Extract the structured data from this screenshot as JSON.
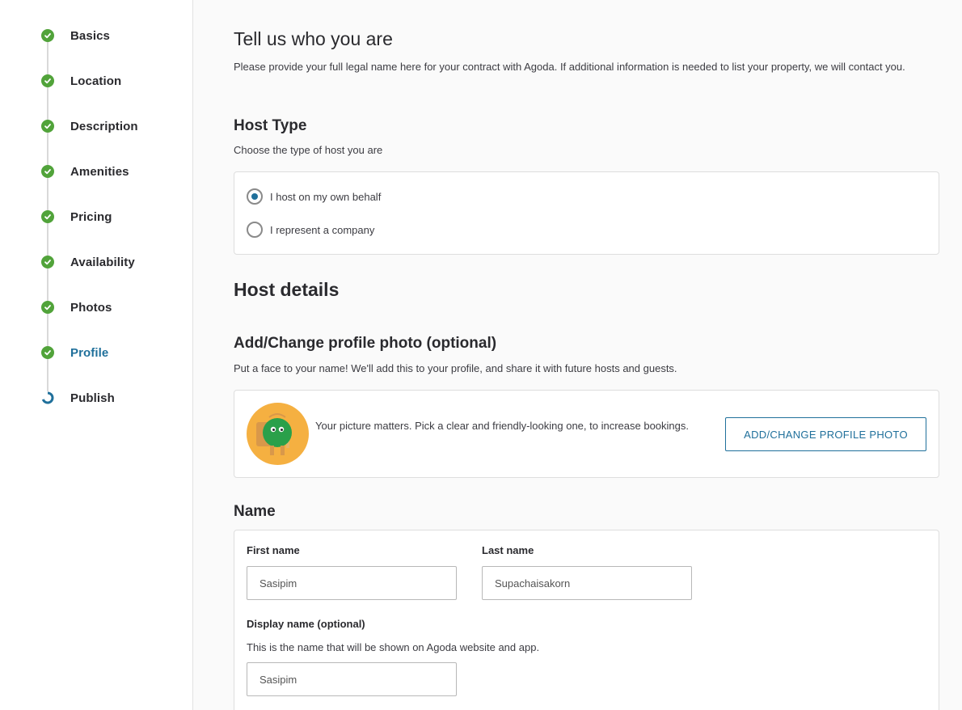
{
  "sidebar": {
    "steps": [
      {
        "label": "Basics",
        "status": "done"
      },
      {
        "label": "Location",
        "status": "done"
      },
      {
        "label": "Description",
        "status": "done"
      },
      {
        "label": "Amenities",
        "status": "done"
      },
      {
        "label": "Pricing",
        "status": "done"
      },
      {
        "label": "Availability",
        "status": "done"
      },
      {
        "label": "Photos",
        "status": "done"
      },
      {
        "label": "Profile",
        "status": "active"
      },
      {
        "label": "Publish",
        "status": "in-progress"
      }
    ]
  },
  "main": {
    "title": "Tell us who you are",
    "intro": "Please provide your full legal name here for your contract with Agoda. If additional information is needed to list your property, we will contact you.",
    "host_type": {
      "heading": "Host Type",
      "subtitle": "Choose the type of host you are",
      "options": [
        {
          "label": "I host on my own behalf",
          "selected": true
        },
        {
          "label": "I represent a company",
          "selected": false
        }
      ]
    },
    "host_details": {
      "heading": "Host details"
    },
    "profile_photo": {
      "heading": "Add/Change profile photo (optional)",
      "subtitle": "Put a face to your name! We'll add this to your profile, and share it with future hosts and guests.",
      "tip": "Your picture matters. Pick a clear and friendly-looking one, to increase bookings.",
      "button_label": "ADD/CHANGE PROFILE PHOTO"
    },
    "name": {
      "heading": "Name",
      "first_name_label": "First name",
      "first_name_value": "Sasipim",
      "last_name_label": "Last name",
      "last_name_value": "Supachaisakorn",
      "display_name_label": "Display name (optional)",
      "display_name_help": "This is the name that will be shown on Agoda website and app.",
      "display_name_value": "Sasipim"
    }
  },
  "colors": {
    "accent": "#20709b",
    "success": "#51a33a",
    "avatar_bg": "#f5b041"
  }
}
